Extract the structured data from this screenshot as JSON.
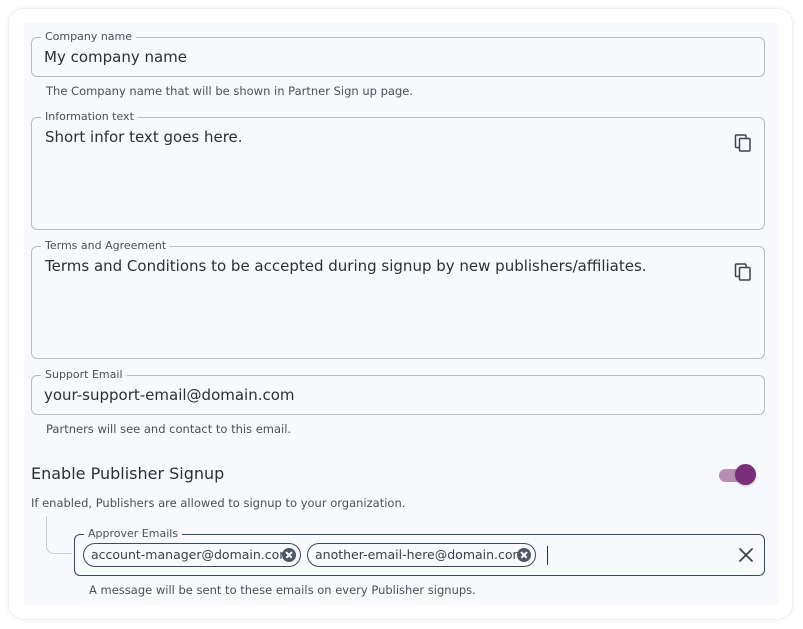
{
  "company_name": {
    "label": "Company name",
    "value": "My company name",
    "helper": "The Company name that will be shown in Partner Sign up page."
  },
  "information_text": {
    "label": "Information text",
    "value": "Short infor text goes here.",
    "copy_icon": "copy-icon"
  },
  "terms": {
    "label": "Terms and Agreement",
    "value": "Terms and Conditions to be accepted during signup by new publishers/affiliates.",
    "copy_icon": "copy-icon"
  },
  "support_email": {
    "label": "Support Email",
    "value": "your-support-email@domain.com",
    "helper": "Partners will see and contact to this email."
  },
  "publisher_signup": {
    "title": "Enable Publisher Signup",
    "enabled": true,
    "helper": "If enabled, Publishers are allowed to signup to your organization.",
    "toggle_color": "#7b2f7a"
  },
  "approver_emails": {
    "label": "Approver Emails",
    "chips": [
      "account-manager@domain.com",
      "another-email-here@domain.com"
    ],
    "helper": "A message will be sent to these emails on every Publisher signups.",
    "clear_icon": "close-icon"
  }
}
